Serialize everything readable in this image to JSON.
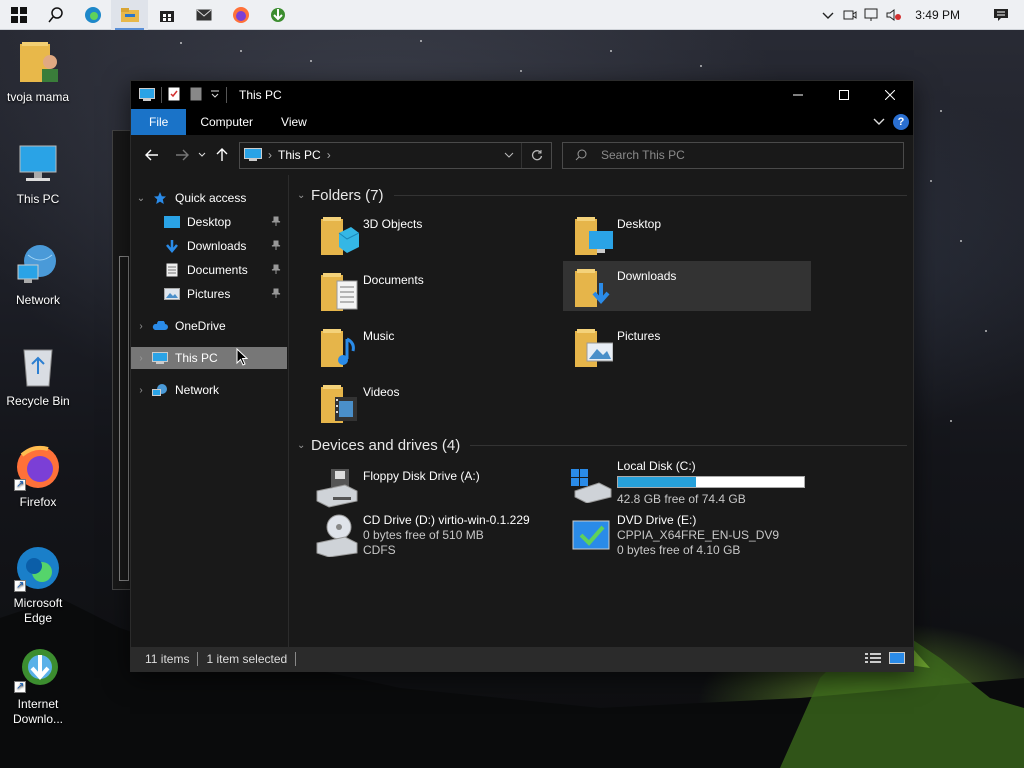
{
  "taskbar": {
    "apps": [
      {
        "name": "start-icon"
      },
      {
        "name": "search-icon"
      },
      {
        "name": "edge-icon"
      },
      {
        "name": "file-explorer-icon",
        "active": true
      },
      {
        "name": "store-icon"
      },
      {
        "name": "mail-icon"
      },
      {
        "name": "firefox-icon"
      },
      {
        "name": "internet-download-manager-icon"
      }
    ],
    "clock": "3:49 PM"
  },
  "desktop": {
    "icons": [
      {
        "label": "tvoja mama",
        "icon": "user-folder-icon"
      },
      {
        "label": "This PC",
        "icon": "this-pc-icon"
      },
      {
        "label": "Network",
        "icon": "network-icon"
      },
      {
        "label": "Recycle Bin",
        "icon": "recycle-bin-icon"
      },
      {
        "label": "Firefox",
        "icon": "firefox-icon"
      },
      {
        "label": "Microsoft Edge",
        "icon": "edge-icon"
      },
      {
        "label": "Internet Downlo...",
        "icon": "internet-download-manager-icon"
      }
    ]
  },
  "window": {
    "title": "This PC",
    "ribbon_tabs": [
      "File",
      "Computer",
      "View"
    ],
    "address": {
      "crumb": "This PC"
    },
    "search": {
      "placeholder": "Search This PC"
    },
    "nav": {
      "quick_access": "Quick access",
      "quick_items": [
        "Desktop",
        "Downloads",
        "Documents",
        "Pictures"
      ],
      "onedrive": "OneDrive",
      "this_pc": "This PC",
      "network": "Network"
    },
    "folders_header": "Folders (7)",
    "folders": [
      {
        "label": "3D Objects",
        "icon": "3d-objects-folder-icon"
      },
      {
        "label": "Desktop",
        "icon": "desktop-folder-icon"
      },
      {
        "label": "Documents",
        "icon": "documents-folder-icon"
      },
      {
        "label": "Downloads",
        "icon": "downloads-folder-icon",
        "selected": true
      },
      {
        "label": "Music",
        "icon": "music-folder-icon"
      },
      {
        "label": "Pictures",
        "icon": "pictures-folder-icon"
      },
      {
        "label": "Videos",
        "icon": "videos-folder-icon"
      }
    ],
    "drives_header": "Devices and drives (4)",
    "drives": [
      {
        "label": "Floppy Disk Drive (A:)",
        "icon": "floppy-drive-icon"
      },
      {
        "label": "Local Disk (C:)",
        "icon": "local-disk-icon",
        "free": "42.8 GB free of 74.4 GB",
        "used_fraction": 0.42
      },
      {
        "label": "CD Drive (D:) virtio-win-0.1.229",
        "icon": "cd-drive-icon",
        "line2": "0 bytes free of 510 MB",
        "line3": "CDFS"
      },
      {
        "label": "DVD Drive (E:)",
        "icon": "dvd-drive-icon",
        "line2": "CPPIA_X64FRE_EN-US_DV9",
        "line3": "0 bytes free of 4.10 GB"
      }
    ],
    "status": {
      "items": "11 items",
      "selected": "1 item selected"
    },
    "colors": {
      "accent": "#1a73c8",
      "drive_fill": "#26a0da",
      "selection": "#777777"
    }
  }
}
